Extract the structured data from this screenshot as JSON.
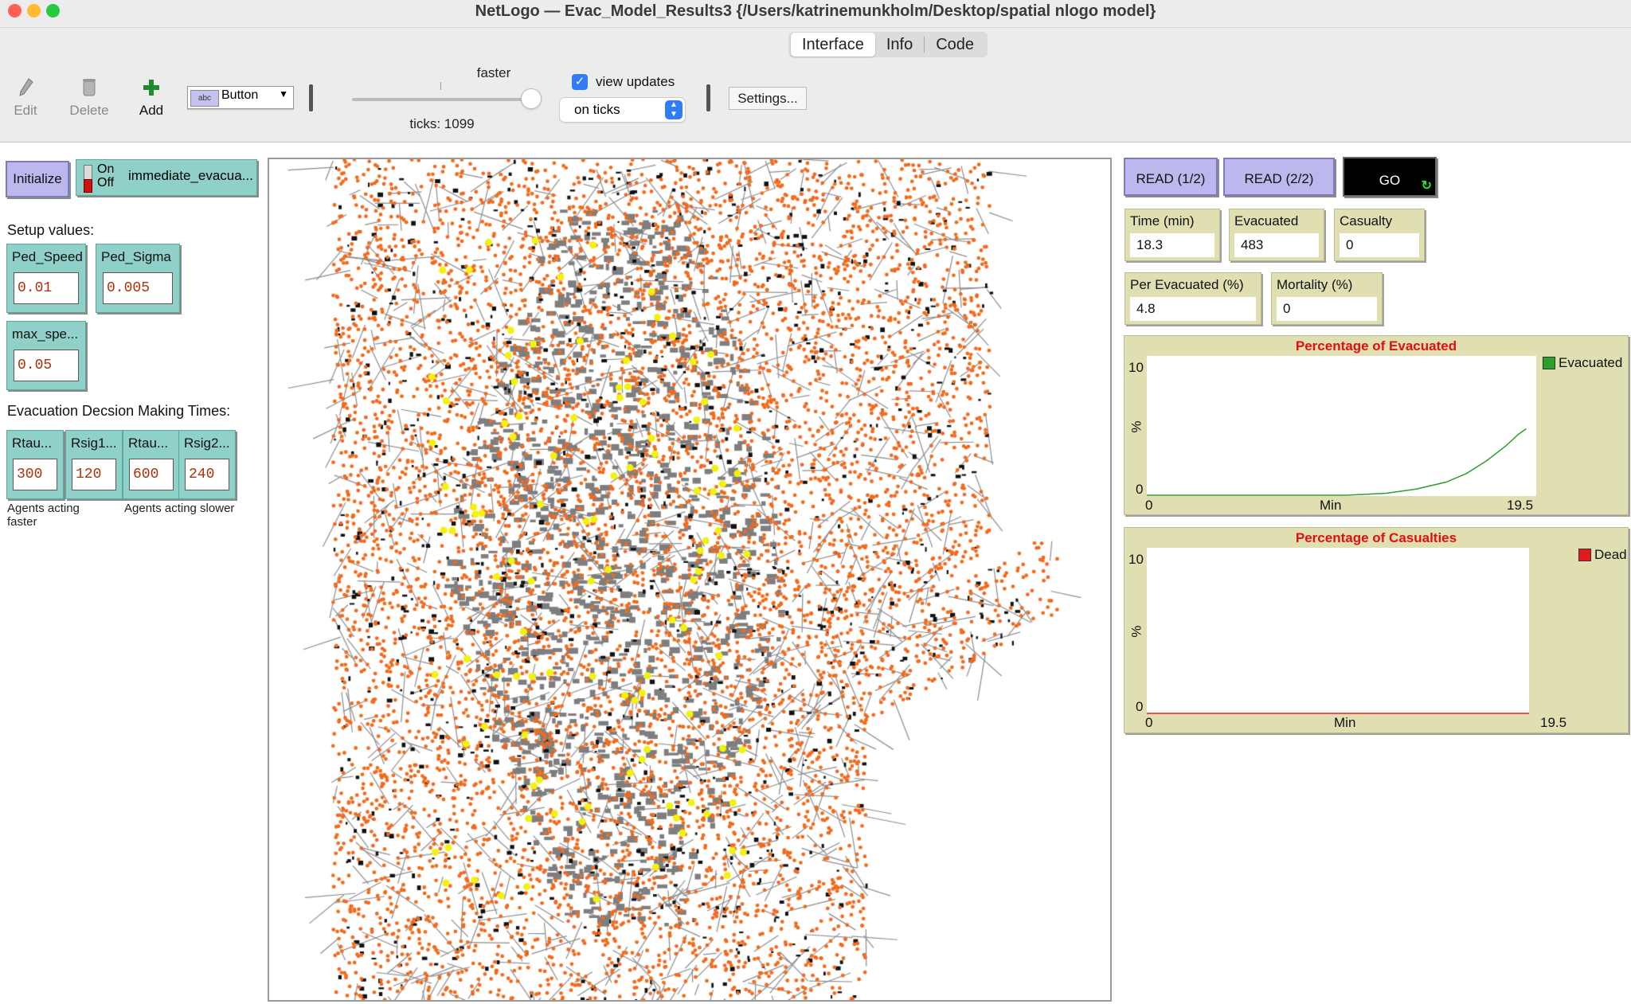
{
  "window": {
    "title": "NetLogo — Evac_Model_Results3 {/Users/katrinemunkholm/Desktop/spatial nlogo model}",
    "traffic_light_colors": [
      "#fe5f57",
      "#febc2e",
      "#28c840"
    ]
  },
  "tabs": [
    {
      "label": "Interface",
      "active": true
    },
    {
      "label": "Info",
      "active": false
    },
    {
      "label": "Code",
      "active": false
    }
  ],
  "toolbar": {
    "edit_label": "Edit",
    "delete_label": "Delete",
    "add_label": "Add",
    "widget_type": "Button",
    "speed_label": "faster",
    "speed_level": 1.0,
    "ticks_text": "ticks: 1099",
    "view_updates_label": "view updates",
    "view_updates_checked": true,
    "update_mode": "on ticks",
    "settings_label": "Settings..."
  },
  "left_panel": {
    "initialize_label": "Initialize",
    "switch": {
      "on_label": "On",
      "off_label": "Off",
      "label": "immediate_evacua...",
      "state": "off"
    },
    "setup_heading": "Setup values:",
    "inputs": [
      {
        "label": "Ped_Speed",
        "value": "0.01"
      },
      {
        "label": "Ped_Sigma",
        "value": "0.005"
      },
      {
        "label": "max_spe...",
        "value": "0.05"
      }
    ],
    "decision_heading": "Evacuation Decsion Making Times:",
    "decision_inputs": [
      {
        "label": "Rtau...",
        "value": "300"
      },
      {
        "label": "Rsig1...",
        "value": "120"
      },
      {
        "label": "Rtau...",
        "value": "600"
      },
      {
        "label": "Rsig2...",
        "value": "240"
      }
    ],
    "note_fast": "Agents acting faster",
    "note_slow": "Agents acting slower"
  },
  "right_panel": {
    "read1_label": "READ (1/2)",
    "read2_label": "READ (2/2)",
    "go_label": "GO",
    "monitors": [
      {
        "label": "Time (min)",
        "value": "18.3"
      },
      {
        "label": "Evacuated",
        "value": "483"
      },
      {
        "label": "Casualty",
        "value": "0"
      },
      {
        "label": "Per Evacuated (%)",
        "value": "4.8"
      },
      {
        "label": "Mortality (%)",
        "value": "0"
      }
    ],
    "plot_evacuated": {
      "title": "Percentage of Evacuated",
      "ymax": "10",
      "ymin": "0",
      "ylabel": "%",
      "xmin": "0",
      "xmax": "19.5",
      "xlabel": "Min",
      "legend": "Evacuated",
      "color": "#2ca02c",
      "points": [
        [
          0,
          0
        ],
        [
          10,
          0.05
        ],
        [
          12,
          0.2
        ],
        [
          13.5,
          0.5
        ],
        [
          15,
          1.0
        ],
        [
          16,
          1.6
        ],
        [
          17,
          2.5
        ],
        [
          18,
          3.6
        ],
        [
          18.6,
          4.4
        ],
        [
          19,
          4.8
        ]
      ]
    },
    "plot_casualties": {
      "title": "Percentage of Casualties",
      "ymax": "10",
      "ymin": "0",
      "ylabel": "%",
      "xmin": "0",
      "xmax": "19.5",
      "xlabel": "Min",
      "legend": "Dead",
      "color": "#e31a1c",
      "points": [
        [
          0,
          0
        ],
        [
          19.5,
          0
        ]
      ]
    }
  },
  "world": {
    "agent_color": "#f26b1d",
    "evacuee_color": "#f2f20a",
    "road_color": "#8c8c8c",
    "building_color": "#111111"
  }
}
